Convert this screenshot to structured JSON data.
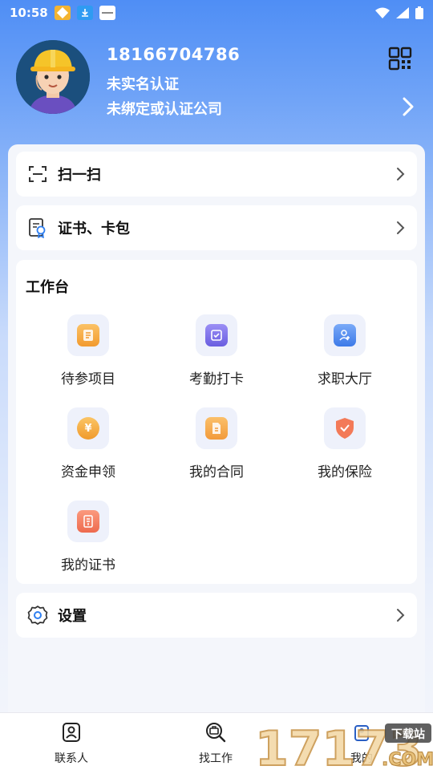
{
  "status_bar": {
    "time": "10:58",
    "icons": [
      "app-icon-1",
      "download-icon",
      "app-icon-3",
      "wifi-icon",
      "signal-icon",
      "battery-icon"
    ]
  },
  "profile": {
    "phone": "18166704786",
    "verify_status": "未实名认证",
    "company_status": "未绑定或认证公司"
  },
  "menu": {
    "scan_label": "扫一扫",
    "cert_wallet_label": "证书、卡包",
    "settings_label": "设置"
  },
  "workbench": {
    "title": "工作台",
    "items": [
      {
        "label": "待参项目",
        "icon": "project-list-icon",
        "color": "#f5a13a"
      },
      {
        "label": "考勤打卡",
        "icon": "attendance-icon",
        "color": "#7b6ee8"
      },
      {
        "label": "求职大厅",
        "icon": "job-hall-icon",
        "color": "#4d8bf0"
      },
      {
        "label": "资金申领",
        "icon": "yuan-coin-icon",
        "color": "#f2a13a"
      },
      {
        "label": "我的合同",
        "icon": "contract-icon",
        "color": "#f5a347"
      },
      {
        "label": "我的保险",
        "icon": "insurance-shield-icon",
        "color": "#f27a5a"
      },
      {
        "label": "我的证书",
        "icon": "certificate-icon",
        "color": "#f2785e"
      }
    ]
  },
  "bottom_nav": {
    "contacts_label": "联系人",
    "jobs_label": "找工作",
    "mine_label": "我的"
  },
  "watermark": {
    "text": "17173",
    "sub": "下载站",
    "domain": ".COM"
  },
  "colors": {
    "accent": "#4f8ef5",
    "card": "#ffffff"
  }
}
